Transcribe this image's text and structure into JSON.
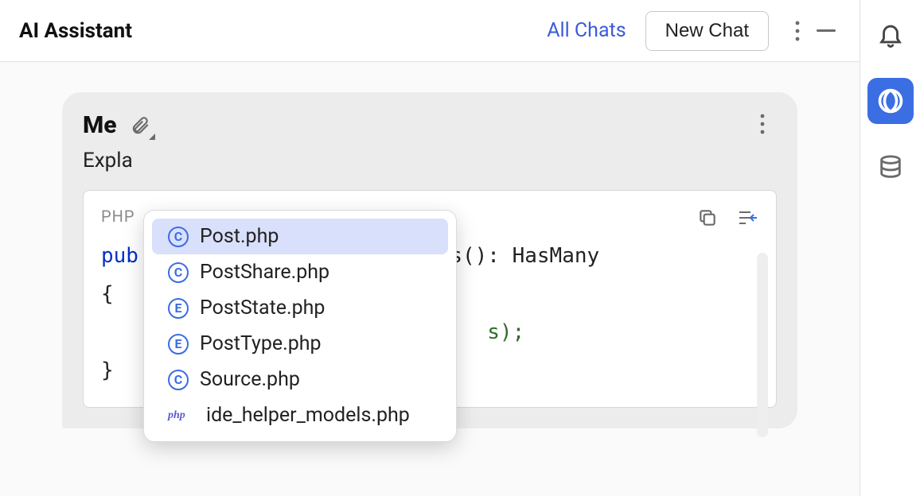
{
  "header": {
    "title": "AI Assistant",
    "all_chats": "All Chats",
    "new_chat": "New Chat"
  },
  "card": {
    "me": "Me",
    "prompt_visible": "Expla"
  },
  "code": {
    "lang": "PHP",
    "line1_prefix": "pub",
    "line1_suffix": "s(): HasMany",
    "line2": "{",
    "line3_suffix": "s);",
    "line4": "}"
  },
  "completion": {
    "items": [
      {
        "kind": "C",
        "label": "Post.php",
        "selected": true
      },
      {
        "kind": "C",
        "label": "PostShare.php",
        "selected": false
      },
      {
        "kind": "E",
        "label": "PostState.php",
        "selected": false
      },
      {
        "kind": "E",
        "label": "PostType.php",
        "selected": false
      },
      {
        "kind": "C",
        "label": "Source.php",
        "selected": false
      },
      {
        "kind": "php",
        "label": "ide_helper_models.php",
        "selected": false
      }
    ]
  }
}
